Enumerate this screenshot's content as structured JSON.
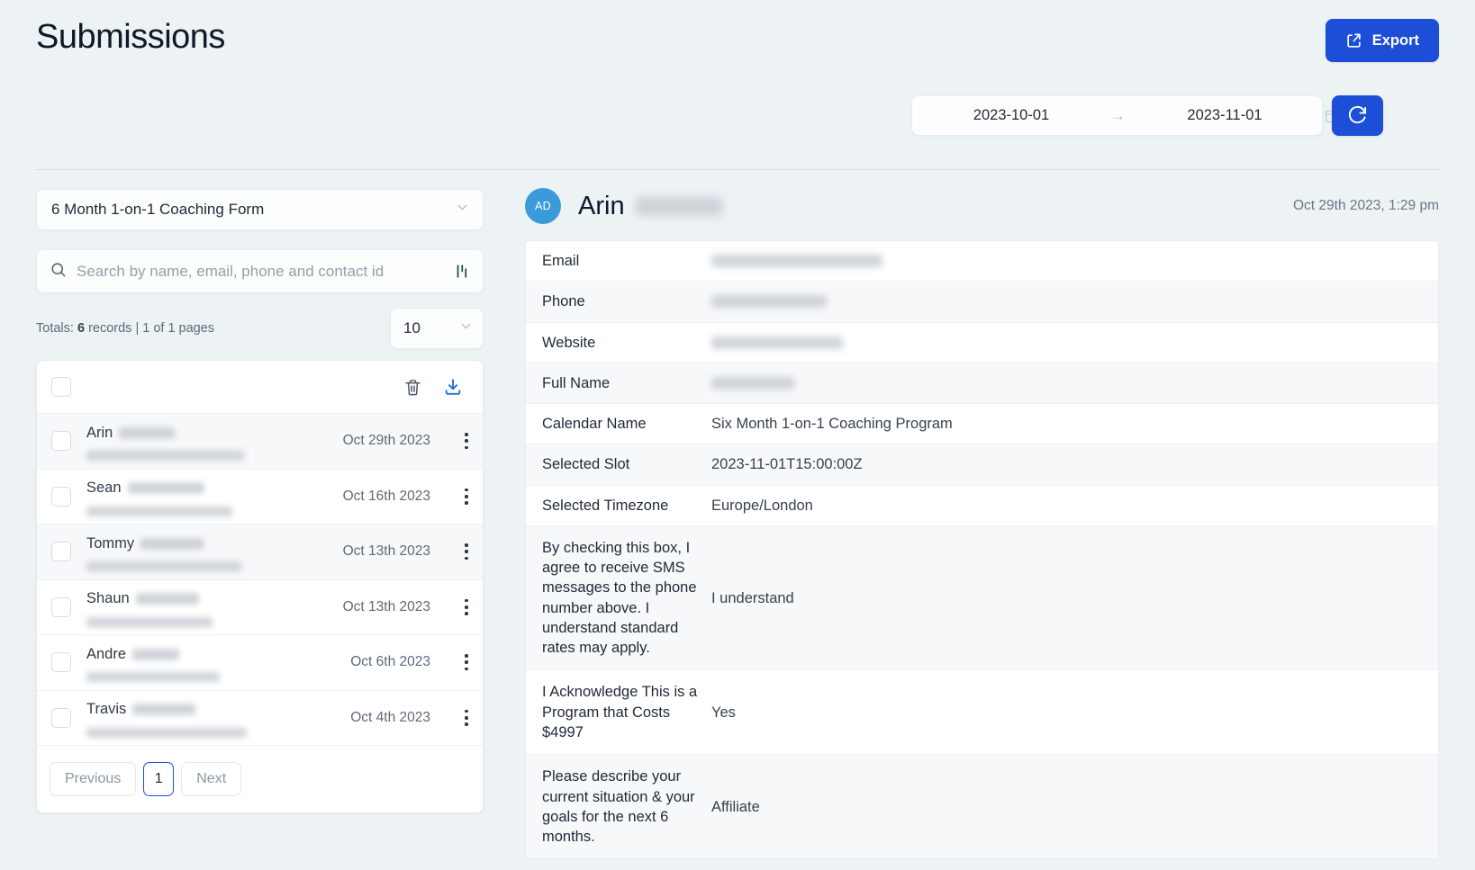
{
  "header": {
    "title": "Submissions",
    "export_label": "Export",
    "export_icon": "export-share-icon",
    "accent_color": "#1d4ed8"
  },
  "filters": {
    "date_from": "2023-10-01",
    "date_to": "2023-11-01",
    "range_arrow": "→",
    "calendar_icon": "calendar-icon",
    "refresh_icon": "refresh-icon"
  },
  "sidebar": {
    "form_selector": {
      "value": "6 Month 1-on-1 Coaching Form",
      "chevron_icon": "chevron-down-icon"
    },
    "search": {
      "placeholder": "Search by name, email, phone and contact id",
      "value": "",
      "search_icon": "search-icon",
      "filter_icon": "sliders-filter-icon"
    },
    "totals": {
      "prefix": "Totals:",
      "count": "6",
      "suffix": "records | 1 of 1 pages",
      "full_text": "Totals: 6 records | 1 of 1 pages"
    },
    "per_page": {
      "value": "10",
      "chevron_icon": "chevron-down-icon"
    },
    "list_actions": {
      "delete_icon": "trash-icon",
      "download_icon": "download-icon"
    },
    "rows": [
      {
        "name": "Arin",
        "date": "Oct 29th 2023",
        "name_redacted_width": 62,
        "sub_redacted_width": 175,
        "selected": true
      },
      {
        "name": "Sean",
        "date": "Oct 16th 2023",
        "name_redacted_width": 85,
        "sub_redacted_width": 162,
        "selected": false
      },
      {
        "name": "Tommy",
        "date": "Oct 13th 2023",
        "name_redacted_width": 70,
        "sub_redacted_width": 172,
        "selected": true
      },
      {
        "name": "Shaun",
        "date": "Oct 13th 2023",
        "name_redacted_width": 70,
        "sub_redacted_width": 140,
        "selected": false
      },
      {
        "name": "Andre",
        "date": "Oct 6th 2023",
        "name_redacted_width": 52,
        "sub_redacted_width": 148,
        "selected": false
      },
      {
        "name": "Travis",
        "date": "Oct 4th 2023",
        "name_redacted_width": 70,
        "sub_redacted_width": 178,
        "selected": false
      }
    ],
    "pagination": {
      "previous_label": "Previous",
      "current_page": "1",
      "next_label": "Next"
    }
  },
  "detail": {
    "avatar_initials": "AD",
    "name": "Arin",
    "name_redacted_width": 96,
    "timestamp": "Oct 29th 2023, 1:29 pm",
    "fields": [
      {
        "key": "Email",
        "value": "",
        "redacted_width": 190
      },
      {
        "key": "Phone",
        "value": "",
        "redacted_width": 128
      },
      {
        "key": "Website",
        "value": "",
        "redacted_width": 146
      },
      {
        "key": "Full Name",
        "value": "",
        "redacted_width": 92
      },
      {
        "key": "Calendar Name",
        "value": "Six Month 1-on-1 Coaching Program",
        "redacted_width": 0
      },
      {
        "key": "Selected Slot",
        "value": "2023-11-01T15:00:00Z",
        "redacted_width": 0
      },
      {
        "key": "Selected Timezone",
        "value": "Europe/London",
        "redacted_width": 0
      },
      {
        "key": "By checking this box, I agree to receive SMS messages to the phone number above. I understand standard rates may apply.",
        "value": "I understand",
        "redacted_width": 0
      },
      {
        "key": "I Acknowledge This is a Program that Costs $4997",
        "value": "Yes",
        "redacted_width": 0
      },
      {
        "key": "Please describe your current situation & your goals for the next 6 months.",
        "value": "Affiliate",
        "redacted_width": 0
      }
    ]
  }
}
